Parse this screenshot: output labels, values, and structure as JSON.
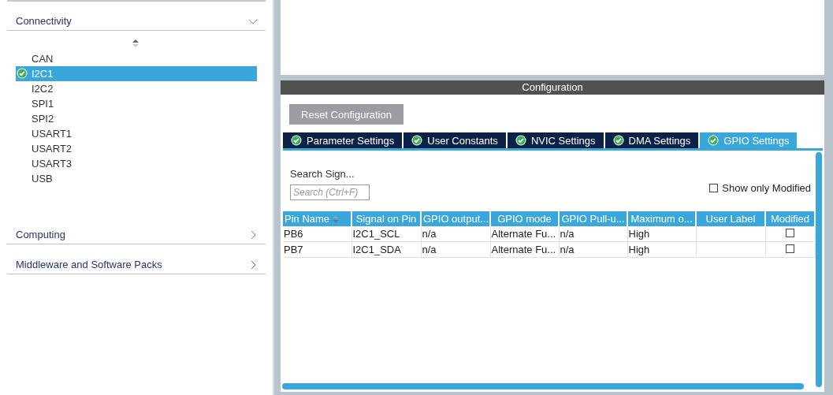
{
  "sidebar": {
    "categories": [
      {
        "label": "Connectivity",
        "expanded": true,
        "items": [
          {
            "label": "CAN",
            "selected": false,
            "configured": false
          },
          {
            "label": "I2C1",
            "selected": true,
            "configured": true
          },
          {
            "label": "I2C2",
            "selected": false,
            "configured": false
          },
          {
            "label": "SPI1",
            "selected": false,
            "configured": false
          },
          {
            "label": "SPI2",
            "selected": false,
            "configured": false
          },
          {
            "label": "USART1",
            "selected": false,
            "configured": false
          },
          {
            "label": "USART2",
            "selected": false,
            "configured": false
          },
          {
            "label": "USART3",
            "selected": false,
            "configured": false
          },
          {
            "label": "USB",
            "selected": false,
            "configured": false
          }
        ]
      },
      {
        "label": "Computing",
        "expanded": false
      },
      {
        "label": "Middleware and Software Packs",
        "expanded": false
      }
    ]
  },
  "configuration": {
    "title": "Configuration",
    "reset_button": "Reset Configuration",
    "tabs": [
      {
        "label": "Parameter Settings",
        "selected": false
      },
      {
        "label": "User Constants",
        "selected": false
      },
      {
        "label": "NVIC Settings",
        "selected": false
      },
      {
        "label": "DMA Settings",
        "selected": false
      },
      {
        "label": "GPIO Settings",
        "selected": true
      }
    ],
    "search_label": "Search Sign...",
    "search": {
      "placeholder": "Search (Ctrl+F)"
    },
    "show_only_modified": {
      "label": "Show only Modified",
      "checked": false
    },
    "table": {
      "columns": [
        {
          "label": "Pin Name",
          "sortable": true
        },
        {
          "label": "Signal on Pin"
        },
        {
          "label": "GPIO output..."
        },
        {
          "label": "GPIO mode"
        },
        {
          "label": "GPIO Pull-u..."
        },
        {
          "label": "Maximum o..."
        },
        {
          "label": "User Label"
        },
        {
          "label": "Modified"
        }
      ],
      "rows": [
        {
          "cells": [
            "PB6",
            "I2C1_SCL",
            "n/a",
            "Alternate Fu...",
            "n/a",
            "High",
            ""
          ],
          "modified": false
        },
        {
          "cells": [
            "PB7",
            "I2C1_SDA",
            "n/a",
            "Alternate Fu...",
            "n/a",
            "High",
            ""
          ],
          "modified": false
        }
      ]
    }
  }
}
